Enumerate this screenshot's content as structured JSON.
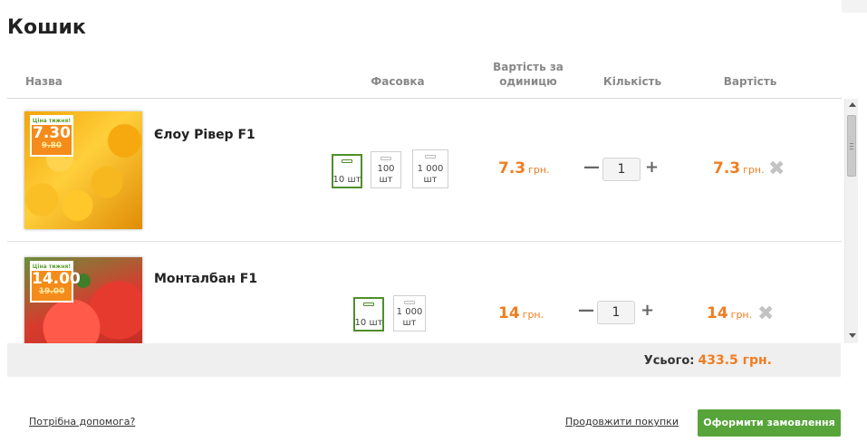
{
  "page_title": "Кошик",
  "headers": {
    "name": "Назва",
    "pack": "Фасовка",
    "unit_price": "Вартість за одиницю",
    "quantity": "Кількість",
    "total": "Вартість"
  },
  "items": [
    {
      "name": "Єлоу Рівер F1",
      "tag": {
        "label": "Ціна тижня!",
        "new_price": "7.30",
        "old_price": "9.80"
      },
      "packs": [
        {
          "label": "10 шт",
          "active": true
        },
        {
          "label": "100 шт",
          "active": false
        },
        {
          "label": "1 000 шт",
          "active": false
        }
      ],
      "unit_price": "7.3",
      "currency": "грн.",
      "quantity": "1",
      "total": "7.3"
    },
    {
      "name": "Монталбан F1",
      "tag": {
        "label": "Ціна тижня!",
        "new_price": "14.00",
        "old_price": "19.00"
      },
      "packs": [
        {
          "label": "10 шт",
          "active": true
        },
        {
          "label": "1 000 шт",
          "active": false
        }
      ],
      "unit_price": "14",
      "currency": "грн.",
      "quantity": "1",
      "total": "14"
    }
  ],
  "summary": {
    "label": "Усього:",
    "amount": "433.5",
    "currency": "грн."
  },
  "footer": {
    "help_link": "Потрібна допомога?",
    "continue_link": "Продовжити покупки",
    "checkout_button": "Оформити замовлення"
  },
  "colors": {
    "accent": "#f07d1f",
    "button": "#57a43a"
  }
}
